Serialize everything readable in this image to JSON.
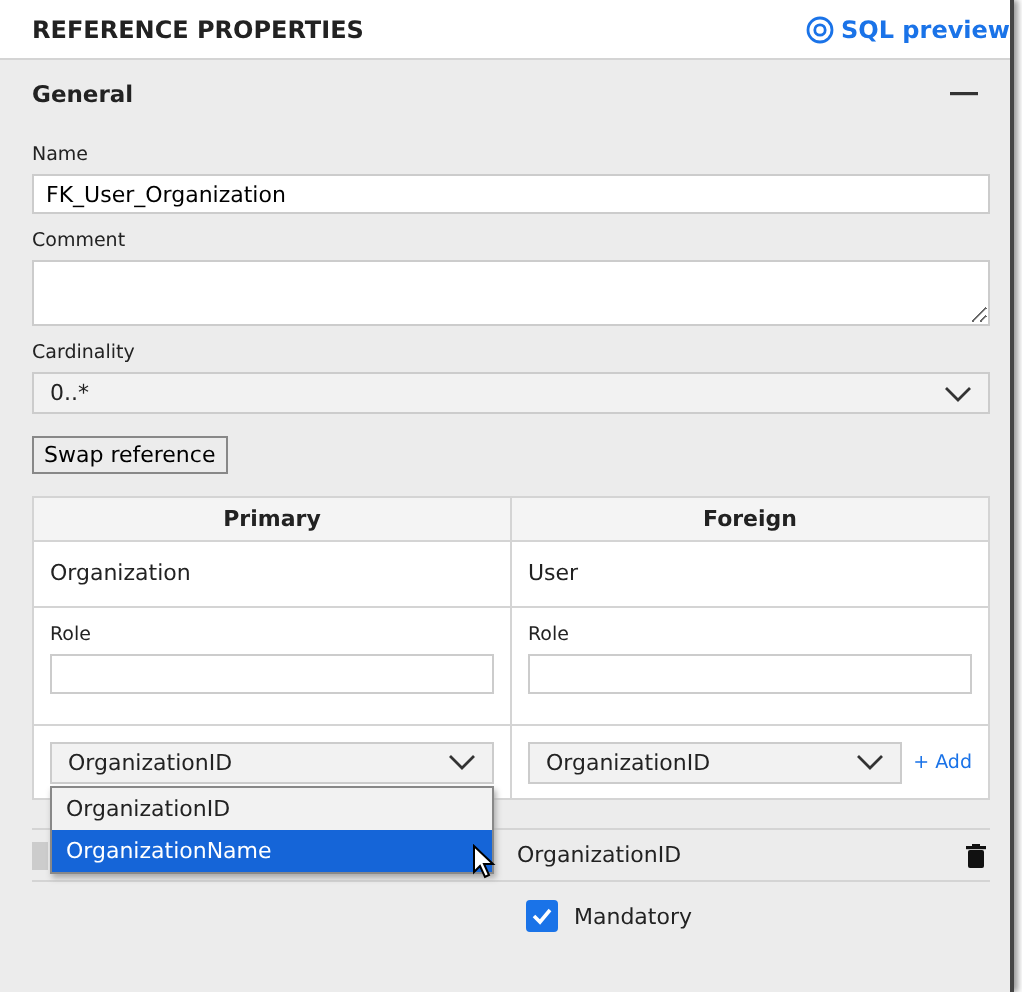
{
  "panel": {
    "title": "REFERENCE PROPERTIES",
    "sql_preview": "SQL preview"
  },
  "section": {
    "title": "General",
    "expanded": true
  },
  "name": {
    "label": "Name",
    "value": "FK_User_Organization"
  },
  "comment": {
    "label": "Comment"
  },
  "cardinality": {
    "label": "Cardinality",
    "value": "0..*"
  },
  "swap_button": "Swap reference",
  "table": {
    "columns": [
      "Primary",
      "Foreign"
    ],
    "entities": [
      "Organization",
      "User"
    ],
    "roles": [
      {
        "label": "Role"
      },
      {
        "label": "Role"
      }
    ],
    "primary_select": "OrganizationID",
    "foreign_select": "OrganizationID",
    "add_link": "+ Add",
    "dropdown": {
      "open": true,
      "options": [
        {
          "label": "OrganizationID",
          "selected": false
        },
        {
          "label": "OrganizationName",
          "selected": true
        }
      ]
    },
    "mapping_foreign": "OrganizationID"
  },
  "mandatory": {
    "label": "Mandatory",
    "checked": true
  }
}
